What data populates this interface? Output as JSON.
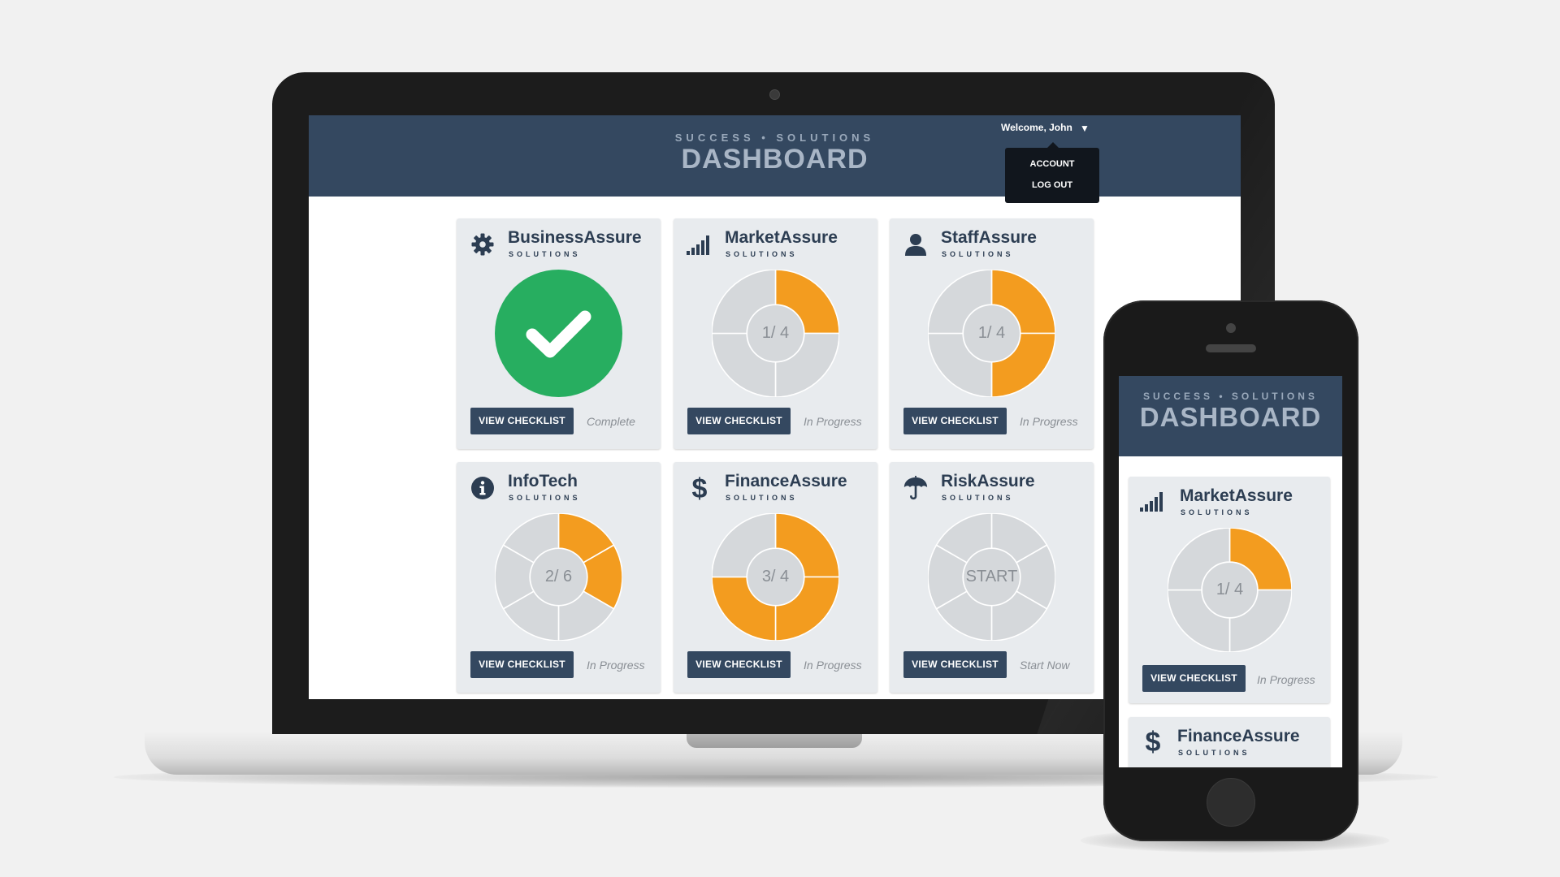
{
  "brand": {
    "subtitle": "SUCCESS • SOLUTIONS",
    "title": "DASHBOARD"
  },
  "user_menu": {
    "welcome": "Welcome, John",
    "items": [
      "ACCOUNT",
      "LOG OUT"
    ]
  },
  "colors": {
    "header": "#344860",
    "progress": "#f39c1f",
    "track": "#d5d8db",
    "complete": "#27ae60",
    "card": "#e8ebee"
  },
  "cards": [
    {
      "title": "BusinessAssure",
      "subtitle": "SOLUTIONS",
      "icon": "gear-icon",
      "progress_label": "",
      "done": 1,
      "total": 1,
      "complete": true,
      "button": "VIEW CHECKLIST",
      "status": "Complete"
    },
    {
      "title": "MarketAssure",
      "subtitle": "SOLUTIONS",
      "icon": "signal-bars-icon",
      "progress_label": "1/ 4",
      "done": 1,
      "total": 4,
      "complete": false,
      "button": "VIEW CHECKLIST",
      "status": "In Progress"
    },
    {
      "title": "StaffAssure",
      "subtitle": "SOLUTIONS",
      "icon": "user-icon",
      "progress_label": "1/ 4",
      "done": 2,
      "total": 4,
      "complete": false,
      "button": "VIEW CHECKLIST",
      "status": "In Progress"
    },
    {
      "title": "InfoTech",
      "subtitle": "SOLUTIONS",
      "icon": "info-icon",
      "progress_label": "2/ 6",
      "done": 2,
      "total": 6,
      "complete": false,
      "button": "VIEW CHECKLIST",
      "status": "In Progress"
    },
    {
      "title": "FinanceAssure",
      "subtitle": "SOLUTIONS",
      "icon": "dollar-icon",
      "progress_label": "3/ 4",
      "done": 3,
      "total": 4,
      "complete": false,
      "button": "VIEW CHECKLIST",
      "status": "In Progress"
    },
    {
      "title": "RiskAssure",
      "subtitle": "SOLUTIONS",
      "icon": "umbrella-icon",
      "progress_label": "START",
      "done": 0,
      "total": 6,
      "complete": false,
      "button": "VIEW CHECKLIST",
      "status": "Start Now"
    }
  ],
  "mobile": {
    "brand": {
      "subtitle": "SUCCESS • SOLUTIONS",
      "title": "DASHBOARD"
    },
    "cards": [
      {
        "title": "MarketAssure",
        "subtitle": "SOLUTIONS",
        "icon": "signal-bars-icon",
        "progress_label": "1/ 4",
        "done": 1,
        "total": 4,
        "button": "VIEW CHECKLIST",
        "status": "In Progress"
      },
      {
        "title": "FinanceAssure",
        "subtitle": "SOLUTIONS",
        "icon": "dollar-icon"
      }
    ]
  }
}
